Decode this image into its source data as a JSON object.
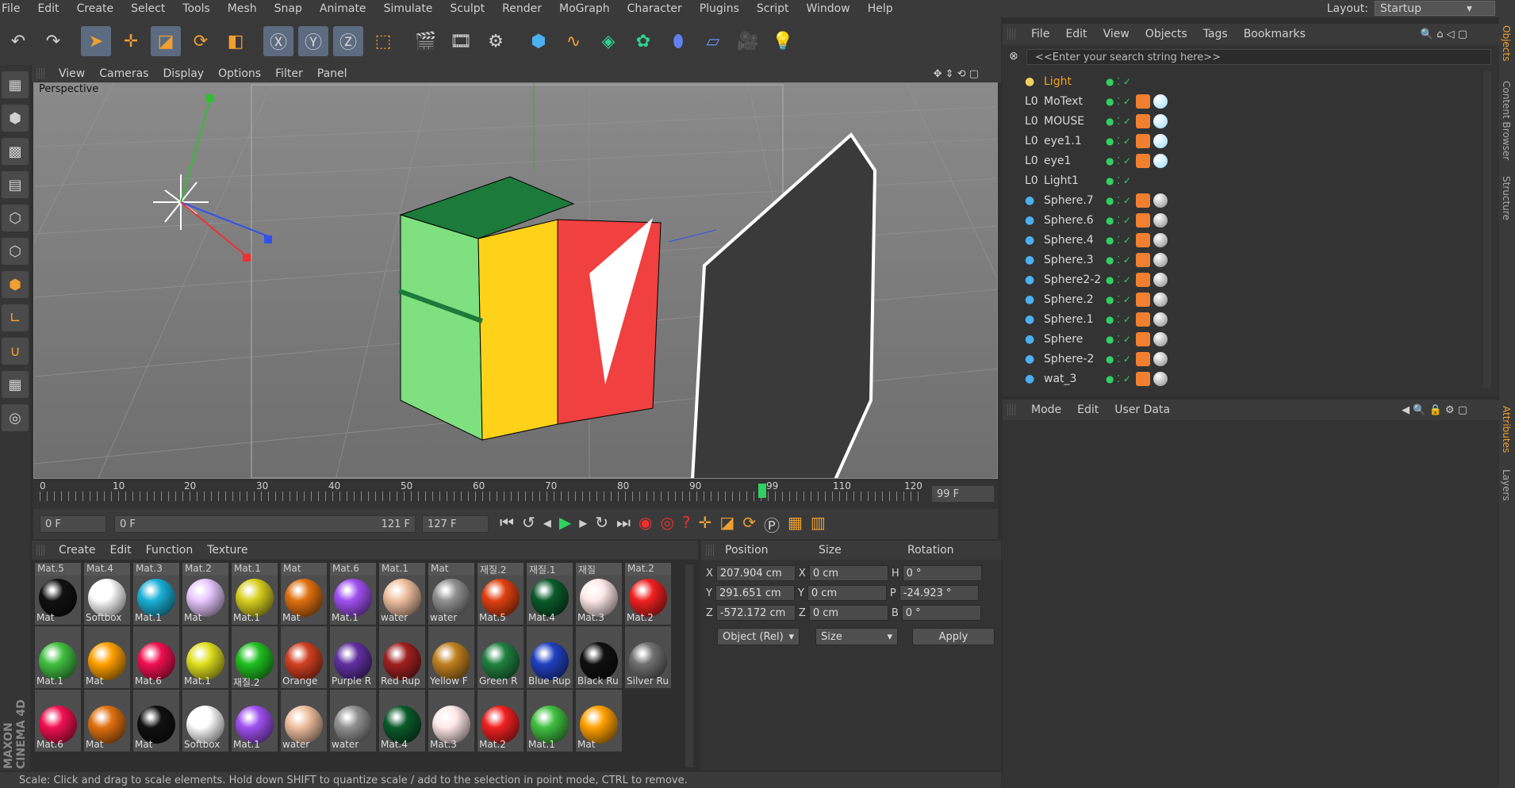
{
  "menubar": {
    "items": [
      "File",
      "Edit",
      "Create",
      "Select",
      "Tools",
      "Mesh",
      "Snap",
      "Animate",
      "Simulate",
      "Sculpt",
      "Render",
      "MoGraph",
      "Character",
      "Plugins",
      "Script",
      "Window",
      "Help"
    ],
    "layout_label": "Layout:",
    "layout_value": "Startup"
  },
  "viewport": {
    "menu": [
      "View",
      "Cameras",
      "Display",
      "Options",
      "Filter",
      "Panel"
    ],
    "label": "Perspective"
  },
  "timeline": {
    "ticks": [
      "0",
      "10",
      "20",
      "30",
      "40",
      "50",
      "60",
      "70",
      "80",
      "90",
      "99",
      "110",
      "120"
    ],
    "current_frame": "99 F",
    "start_field": "0 F",
    "range_start": "0 F",
    "range_end": "121 F",
    "end_field": "127 F"
  },
  "materials": {
    "menu": [
      "Create",
      "Edit",
      "Function",
      "Texture"
    ],
    "rows": [
      [
        {
          "top": "Mat.5",
          "name": "Mat",
          "color": "#111"
        },
        {
          "top": "Mat.4",
          "name": "Softbox",
          "color": "#fff"
        },
        {
          "top": "Mat.3",
          "name": "Mat.1",
          "color": "#1ab0d8"
        },
        {
          "top": "Mat.2",
          "name": "Mat",
          "color": "#e8c8ff"
        },
        {
          "top": "Mat.1",
          "name": "Mat.1",
          "color": "#d8d020"
        },
        {
          "top": "Mat",
          "name": "Mat",
          "color": "#e07010"
        },
        {
          "top": "Mat.6",
          "name": "Mat.1",
          "color": "#a050f0"
        },
        {
          "top": "Mat.1",
          "name": "water",
          "color": "#f0c0a0"
        },
        {
          "top": "Mat",
          "name": "water",
          "color": "#909090"
        },
        {
          "top": "재질.2",
          "name": "Mat.5",
          "color": "#e04010"
        },
        {
          "top": "재질.1",
          "name": "Mat.4",
          "color": "#0a5a2a"
        },
        {
          "top": "재질",
          "name": "Mat.3",
          "color": "#ffe8e8"
        },
        {
          "top": "Mat.2",
          "name": "Mat.2",
          "color": "#f02020"
        }
      ],
      [
        {
          "name": "Mat.1",
          "color": "#40c040"
        },
        {
          "name": "Mat",
          "color": "#ffa000"
        },
        {
          "name": "Mat.6",
          "color": "#f01050"
        },
        {
          "name": "Mat.1",
          "color": "#e0e020"
        },
        {
          "name": "재질.2",
          "color": "#20c020"
        },
        {
          "name": "Orange",
          "color": "#d04020"
        },
        {
          "name": "Purple R",
          "color": "#6030a0"
        },
        {
          "name": "Red Rup",
          "color": "#a02020"
        },
        {
          "name": "Yellow F",
          "color": "#c08020"
        },
        {
          "name": "Green R",
          "color": "#208040"
        },
        {
          "name": "Blue Rup",
          "color": "#2040c0"
        },
        {
          "name": "Black Ru",
          "color": "#101010"
        },
        {
          "name": "Silver Ru",
          "color": "#707070"
        }
      ],
      [
        {
          "name": "Mat.6",
          "color": "#f01050"
        },
        {
          "name": "Mat",
          "color": "#e07010"
        },
        {
          "name": "Mat",
          "color": "#111"
        },
        {
          "name": "Softbox",
          "color": "#fff"
        },
        {
          "name": "Mat.1",
          "color": "#a050f0"
        },
        {
          "name": "water",
          "color": "#f0c0a0"
        },
        {
          "name": "water",
          "color": "#909090"
        },
        {
          "name": "Mat.4",
          "color": "#0a5a2a"
        },
        {
          "name": "Mat.3",
          "color": "#ffe8e8"
        },
        {
          "name": "Mat.2",
          "color": "#f02020"
        },
        {
          "name": "Mat.1",
          "color": "#40c040"
        },
        {
          "name": "Mat",
          "color": "#ffa000"
        }
      ]
    ]
  },
  "coords": {
    "headers": [
      "Position",
      "Size",
      "Rotation"
    ],
    "rows": [
      {
        "axis": "X",
        "pos": "207.904 cm",
        "saxis": "X",
        "size": "0 cm",
        "raxis": "H",
        "rot": "0 °"
      },
      {
        "axis": "Y",
        "pos": "291.651 cm",
        "saxis": "Y",
        "size": "0 cm",
        "raxis": "P",
        "rot": "-24.923 °"
      },
      {
        "axis": "Z",
        "pos": "-572.172 cm",
        "saxis": "Z",
        "size": "0 cm",
        "raxis": "B",
        "rot": "0 °"
      }
    ],
    "mode": "Object (Rel)",
    "size_mode": "Size",
    "apply": "Apply"
  },
  "objects": {
    "menu": [
      "File",
      "Edit",
      "View",
      "Objects",
      "Tags",
      "Bookmarks"
    ],
    "search_placeholder": "<<Enter your search string here>>",
    "items": [
      {
        "name": "Light",
        "color": "#f0a020"
      },
      {
        "name": "MoText"
      },
      {
        "name": "MOUSE"
      },
      {
        "name": "eye1.1"
      },
      {
        "name": "eye1"
      },
      {
        "name": "Light1"
      },
      {
        "name": "Sphere.7"
      },
      {
        "name": "Sphere.6"
      },
      {
        "name": "Sphere.4"
      },
      {
        "name": "Sphere.3"
      },
      {
        "name": "Sphere2-2"
      },
      {
        "name": "Sphere.2"
      },
      {
        "name": "Sphere.1"
      },
      {
        "name": "Sphere"
      },
      {
        "name": "Sphere-2"
      },
      {
        "name": "wat_3"
      }
    ]
  },
  "attributes": {
    "menu": [
      "Mode",
      "Edit",
      "User Data"
    ]
  },
  "side_tabs": [
    "Objects",
    "Content Browser",
    "Structure",
    "Attributes",
    "Layers"
  ],
  "status": "Scale: Click and drag to scale elements. Hold down SHIFT to quantize scale / add to the selection in point mode, CTRL to remove.",
  "brand": "MAXON CINEMA 4D"
}
